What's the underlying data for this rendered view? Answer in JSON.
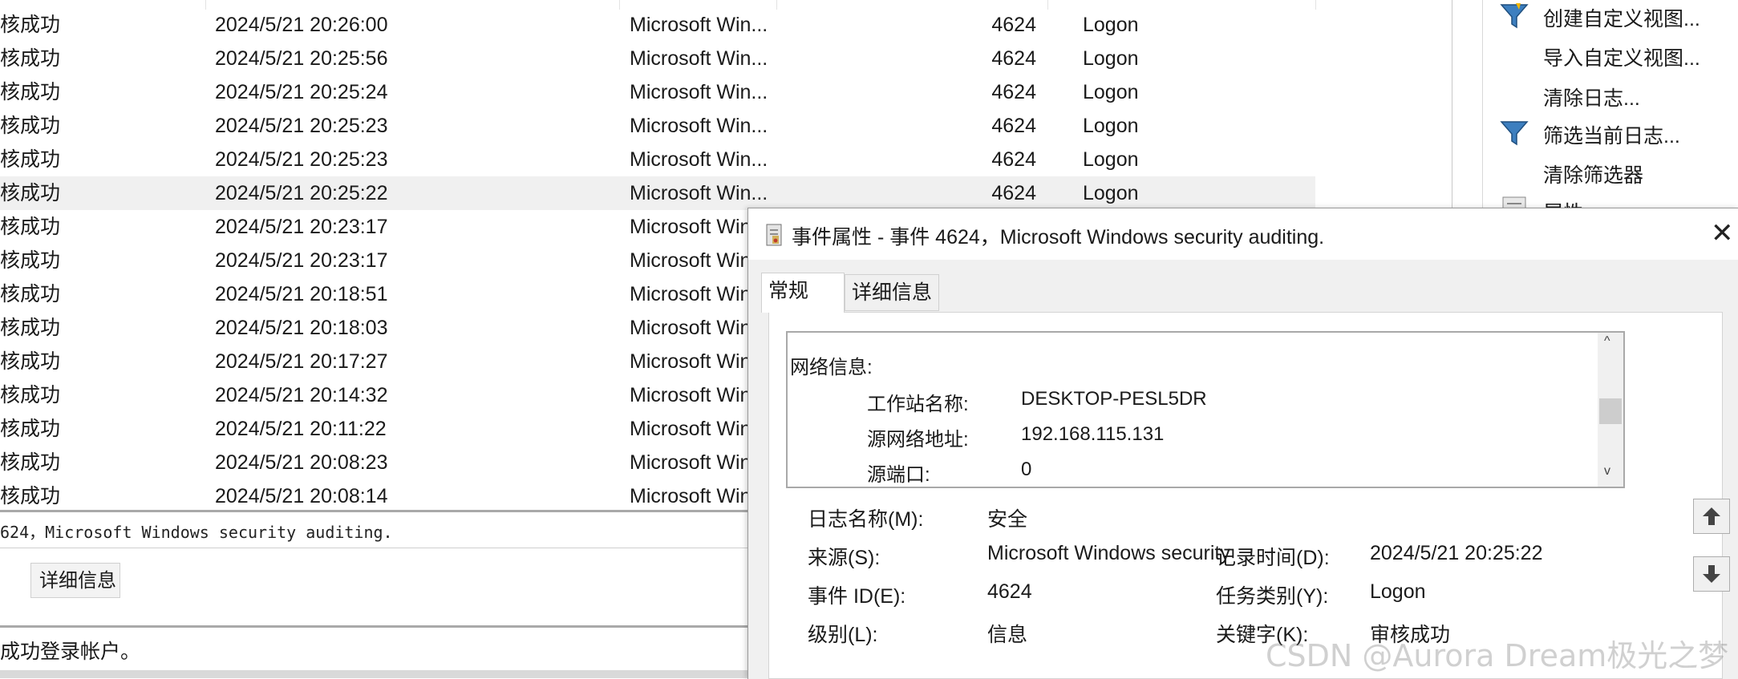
{
  "event_list": {
    "rows": [
      {
        "level": "核成功",
        "date": "2024/5/21 20:26:00",
        "source": "Microsoft Win...",
        "id": "4624",
        "category": "Logon"
      },
      {
        "level": "核成功",
        "date": "2024/5/21 20:25:56",
        "source": "Microsoft Win...",
        "id": "4624",
        "category": "Logon"
      },
      {
        "level": "核成功",
        "date": "2024/5/21 20:25:24",
        "source": "Microsoft Win...",
        "id": "4624",
        "category": "Logon"
      },
      {
        "level": "核成功",
        "date": "2024/5/21 20:25:23",
        "source": "Microsoft Win...",
        "id": "4624",
        "category": "Logon"
      },
      {
        "level": "核成功",
        "date": "2024/5/21 20:25:23",
        "source": "Microsoft Win...",
        "id": "4624",
        "category": "Logon"
      },
      {
        "level": "核成功",
        "date": "2024/5/21 20:25:22",
        "source": "Microsoft Win...",
        "id": "4624",
        "category": "Logon",
        "selected": true
      },
      {
        "level": "核成功",
        "date": "2024/5/21 20:23:17",
        "source": "Microsoft Win",
        "id": "",
        "category": ""
      },
      {
        "level": "核成功",
        "date": "2024/5/21 20:23:17",
        "source": "Microsoft Win",
        "id": "",
        "category": ""
      },
      {
        "level": "核成功",
        "date": "2024/5/21 20:18:51",
        "source": "Microsoft Win",
        "id": "",
        "category": ""
      },
      {
        "level": "核成功",
        "date": "2024/5/21 20:18:03",
        "source": "Microsoft Win",
        "id": "",
        "category": ""
      },
      {
        "level": "核成功",
        "date": "2024/5/21 20:17:27",
        "source": "Microsoft Win",
        "id": "",
        "category": ""
      },
      {
        "level": "核成功",
        "date": "2024/5/21 20:14:32",
        "source": "Microsoft Win",
        "id": "",
        "category": ""
      },
      {
        "level": "核成功",
        "date": "2024/5/21 20:11:22",
        "source": "Microsoft Win",
        "id": "",
        "category": ""
      },
      {
        "level": "核成功",
        "date": "2024/5/21 20:08:23",
        "source": "Microsoft Win",
        "id": "",
        "category": ""
      },
      {
        "level": "核成功",
        "date": "2024/5/21 20:08:14",
        "source": "Microsoft Win",
        "id": "",
        "category": ""
      }
    ]
  },
  "preview": {
    "title": "624，Microsoft Windows security auditing.",
    "tab_details": "详细信息",
    "description": "成功登录帐户。"
  },
  "actions": {
    "items": [
      {
        "label": "创建自定义视图...",
        "icon": "filter-icon"
      },
      {
        "label": "导入自定义视图...",
        "icon": ""
      },
      {
        "label": "清除日志...",
        "icon": ""
      },
      {
        "label": "筛选当前日志...",
        "icon": "filter-icon"
      },
      {
        "label": "清除筛选器",
        "icon": ""
      },
      {
        "label": "属性",
        "icon": "properties-icon"
      }
    ]
  },
  "dialog": {
    "title": "事件属性 - 事件 4624，Microsoft Windows security auditing.",
    "tabs": {
      "general": "常规",
      "details": "详细信息"
    },
    "description": {
      "section": "网络信息:",
      "workstation_label": "工作站名称:",
      "workstation_value": "DESKTOP-PESL5DR",
      "src_addr_label": "源网络地址:",
      "src_addr_value": "192.168.115.131",
      "src_port_label": "源端口:",
      "src_port_value": "0"
    },
    "fields": {
      "log_name_label": "日志名称(M):",
      "log_name_value": "安全",
      "source_label": "来源(S):",
      "source_value": "Microsoft Windows security",
      "event_id_label": "事件 ID(E):",
      "event_id_value": "4624",
      "level_label": "级别(L):",
      "level_value": "信息",
      "logged_label": "记录时间(D):",
      "logged_value": "2024/5/21 20:25:22",
      "task_label": "任务类别(Y):",
      "task_value": "Logon",
      "keywords_label": "关键字(K):",
      "keywords_value": "审核成功"
    }
  },
  "watermark": "CSDN @Aurora Dream极光之梦"
}
